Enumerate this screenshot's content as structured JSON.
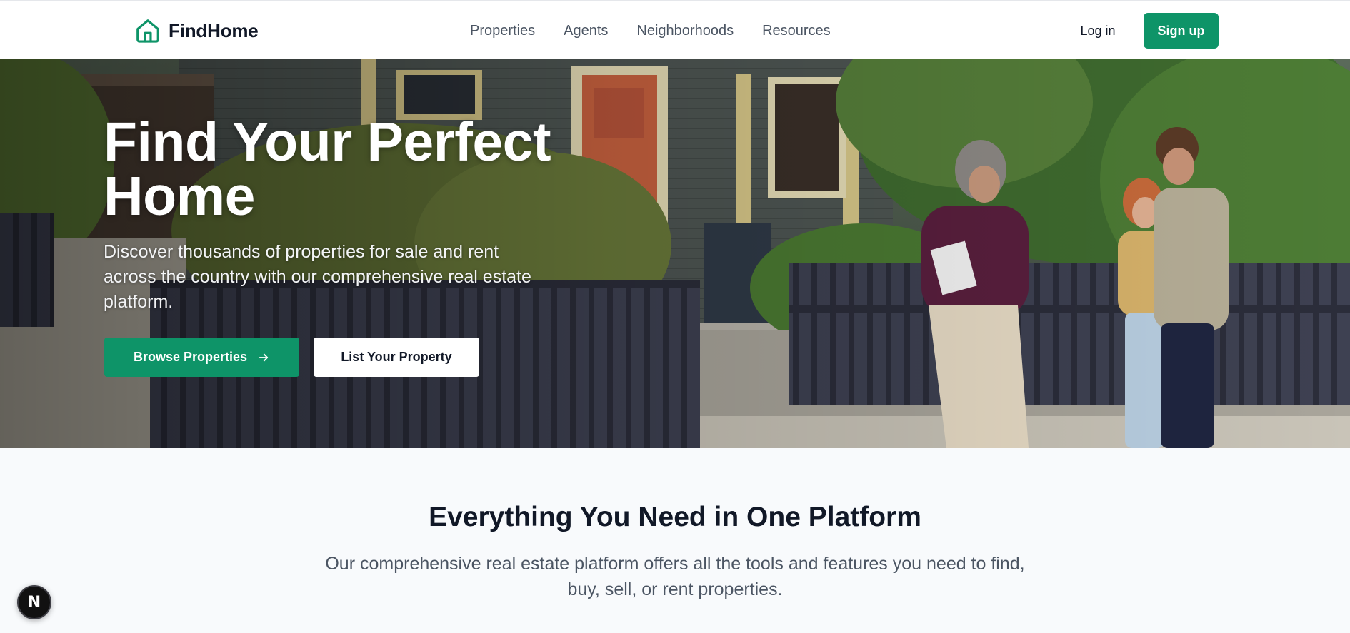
{
  "brand": {
    "name": "FindHome",
    "icon": "house-icon",
    "accent_color": "#0e9468"
  },
  "nav": {
    "items": [
      {
        "label": "Properties"
      },
      {
        "label": "Agents"
      },
      {
        "label": "Neighborhoods"
      },
      {
        "label": "Resources"
      }
    ]
  },
  "auth": {
    "login_label": "Log in",
    "signup_label": "Sign up"
  },
  "hero": {
    "title_line1": "Find Your Perfect",
    "title_line2": "Home",
    "subtitle": "Discover thousands of properties for sale and rent across the country with our comprehensive real estate platform.",
    "primary_cta": "Browse Properties",
    "primary_cta_icon": "arrow-right-icon",
    "secondary_cta": "List Your Property"
  },
  "features": {
    "title": "Everything You Need in One Platform",
    "subtitle": "Our comprehensive real estate platform offers all the tools and features you need to find, buy, sell, or rent properties."
  },
  "dev_badge": {
    "label": "N"
  }
}
